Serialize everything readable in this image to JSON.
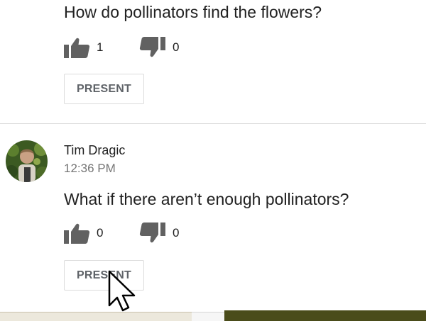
{
  "question_1": {
    "text": "How do pollinators find the flowers?",
    "likes": "1",
    "dislikes": "0",
    "present_label": "PRESENT"
  },
  "question_2": {
    "author": "Tim Dragic",
    "time": "12:36 PM",
    "text": "What if there aren’t enough pollinators?",
    "likes": "0",
    "dislikes": "0",
    "present_label": "PRESENT"
  },
  "icons": {
    "like": "thumbs-up-icon",
    "dislike": "thumbs-down-icon",
    "cursor": "arrow-cursor"
  },
  "colors": {
    "icon": "#616161",
    "divider": "#dadada",
    "secondary_text": "#757575"
  }
}
